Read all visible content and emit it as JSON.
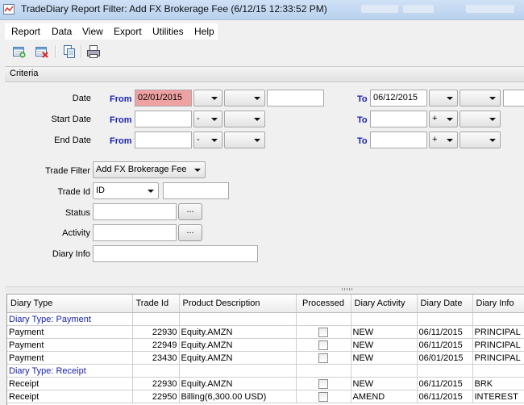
{
  "window": {
    "title": "TradeDiary Report Filter: Add FX Brokerage Fee (6/12/15 12:33:52 PM)"
  },
  "menu": [
    "Report",
    "Data",
    "View",
    "Export",
    "Utilities",
    "Help"
  ],
  "toolbar": [
    "add-report-icon",
    "delete-report-icon",
    "copy-icon",
    "print-icon"
  ],
  "criteria": {
    "header": "Criteria",
    "date_rows": [
      {
        "label": "Date",
        "from_label": "From",
        "from_value": "02/01/2015",
        "from_sign": "",
        "to_label": "To",
        "to_value": "06/12/2015",
        "to_sign": ""
      },
      {
        "label": "Start Date",
        "from_label": "From",
        "from_value": "",
        "from_sign": "-",
        "to_label": "To",
        "to_value": "",
        "to_sign": "+"
      },
      {
        "label": "End Date",
        "from_label": "From",
        "from_value": "",
        "from_sign": "-",
        "to_label": "To",
        "to_value": "",
        "to_sign": "+"
      }
    ],
    "trade_filter": {
      "label": "Trade Filter",
      "value": "Add FX Brokerage Fee"
    },
    "trade_id": {
      "label": "Trade Id",
      "type_value": "ID",
      "value": ""
    },
    "status": {
      "label": "Status",
      "value": "",
      "button": "..."
    },
    "activity": {
      "label": "Activity",
      "value": "",
      "button": "..."
    },
    "diary_info": {
      "label": "Diary Info",
      "value": ""
    }
  },
  "grid": {
    "columns": [
      "Diary Type",
      "Trade Id",
      "Product Description",
      "Processed",
      "Diary Activity",
      "Diary Date",
      "Diary Info"
    ],
    "groups": [
      {
        "title": "Diary Type: Payment",
        "rows": [
          {
            "type": "Payment",
            "trade_id": "22930",
            "product": "Equity.AMZN",
            "processed": false,
            "activity": "NEW",
            "date": "06/11/2015",
            "info": "PRINCIPAL"
          },
          {
            "type": "Payment",
            "trade_id": "22949",
            "product": "Equity.AMZN",
            "processed": false,
            "activity": "NEW",
            "date": "06/11/2015",
            "info": "PRINCIPAL"
          },
          {
            "type": "Payment",
            "trade_id": "23430",
            "product": "Equity.AMZN",
            "processed": false,
            "activity": "NEW",
            "date": "06/01/2015",
            "info": "PRINCIPAL"
          }
        ]
      },
      {
        "title": "Diary Type: Receipt",
        "rows": [
          {
            "type": "Receipt",
            "trade_id": "22930",
            "product": "Equity.AMZN",
            "processed": false,
            "activity": "NEW",
            "date": "06/11/2015",
            "info": "BRK"
          },
          {
            "type": "Receipt",
            "trade_id": "22950",
            "product": "Billing(6,300.00 USD)",
            "processed": false,
            "activity": "AMEND",
            "date": "06/11/2015",
            "info": "INTEREST"
          }
        ]
      }
    ]
  }
}
